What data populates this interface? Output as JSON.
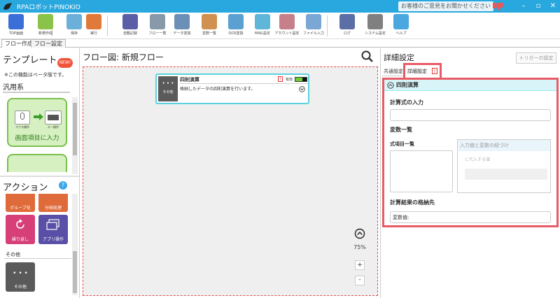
{
  "app": {
    "title": "RPAロボットPINOKIO",
    "feedback": "お客様のご意見をお聞かせください"
  },
  "toolbar": {
    "items": [
      {
        "label": "TOP画面",
        "color": "#3a6fd8"
      },
      {
        "label": "新規作成",
        "color": "#8bc34a"
      },
      {
        "label": "保存",
        "color": "#6bb0d8"
      },
      {
        "label": "実行",
        "color": "#e07a3a"
      },
      {
        "label": "自動記録",
        "color": "#5b5ea6"
      },
      {
        "label": "フロー一覧",
        "color": "#8899aa"
      },
      {
        "label": "データ変換",
        "color": "#6c8fb8"
      },
      {
        "label": "変数一覧",
        "color": "#d09050"
      },
      {
        "label": "OCR変換",
        "color": "#5aa0d0"
      },
      {
        "label": "MAIL設定",
        "color": "#5fb6d9"
      },
      {
        "label": "アカウント設定",
        "color": "#c77f8a"
      },
      {
        "label": "ファイル入力",
        "color": "#7aa7d4"
      },
      {
        "label": "ログ",
        "color": "#5b6ea6"
      },
      {
        "label": "システム設定",
        "color": "#808080"
      },
      {
        "label": "ヘルプ",
        "color": "#4aa8e0"
      }
    ]
  },
  "tabs": {
    "flow_create": "フロー作成",
    "flow_settings": "フロー設定"
  },
  "left": {
    "template_title": "テンプレート",
    "new_badge": "NEW!",
    "beta_note": "※この機能はベータ版です。",
    "general": "汎用系",
    "card1_caption": "画面項目に入力",
    "card1_left": "マウス操作",
    "card1_right": "キー操作",
    "action_title": "アクション",
    "help": "?",
    "tiles": [
      "グループ化",
      "分岐処理",
      "繰り返し",
      "アプリ操作"
    ],
    "other_section": "その他",
    "other_tile": "その他",
    "dots": "• • •"
  },
  "canvas": {
    "title": "フロー図: 新規フロー",
    "node_title": "四則演算",
    "node_status": "有効",
    "node_desc": "格納したデータの四則演算を行います。",
    "node_tag": "その他",
    "node_dots": "• • •",
    "zoom": "75%",
    "plus": "+",
    "minus": "-"
  },
  "right": {
    "title": "詳細設定",
    "trigger_btn": "トリガーの設定",
    "tab_common": "共通設定",
    "tab_detail": "詳細設定",
    "section": "四則演算",
    "formula_label": "計算式の入力",
    "formula_value": "",
    "vars_label": "変数一覧",
    "expr_list_label": "式項目一覧",
    "binding_label": "入力値と変数の紐づけ",
    "assign_label": "に代入する値",
    "result_label": "計算結果の格納先",
    "result_value": "変数値:"
  }
}
